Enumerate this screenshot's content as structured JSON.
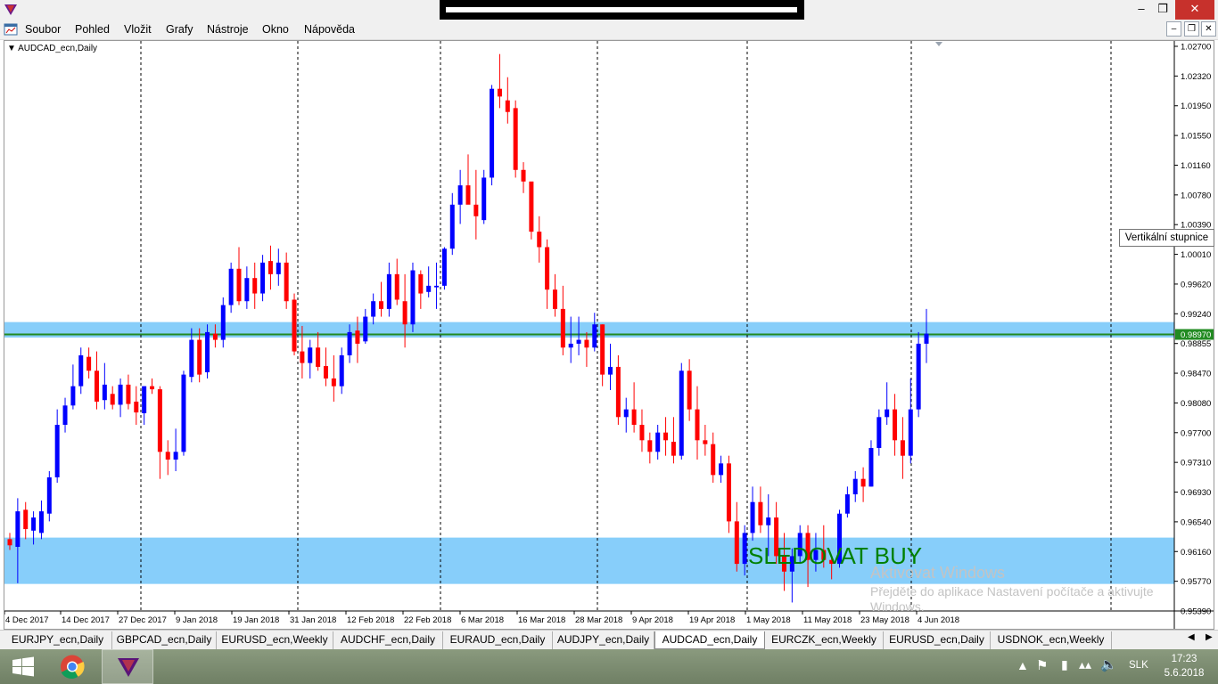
{
  "menu": {
    "items": [
      "Soubor",
      "Pohled",
      "Vložit",
      "Grafy",
      "Nástroje",
      "Okno",
      "Nápověda"
    ]
  },
  "chart": {
    "symbol": "AUDCAD_ecn,Daily",
    "tooltip": "Vertikální stupnice",
    "price_labels": [
      "1.02700",
      "1.02320",
      "1.01950",
      "1.01550",
      "1.01160",
      "1.00780",
      "1.00390",
      "1.00010",
      "0.99620",
      "0.99240",
      "0.98855",
      "0.98470",
      "0.98080",
      "0.97700",
      "0.97310",
      "0.96930",
      "0.96540",
      "0.96160",
      "0.95770",
      "0.95390"
    ],
    "current_price": "0.98970",
    "date_labels": [
      "4 Dec 2017",
      "14 Dec 2017",
      "27 Dec 2017",
      "9 Jan 2018",
      "19 Jan 2018",
      "31 Jan 2018",
      "12 Feb 2018",
      "22 Feb 2018",
      "6 Mar 2018",
      "16 Mar 2018",
      "28 Mar 2018",
      "9 Apr 2018",
      "19 Apr 2018",
      "1 May 2018",
      "11 May 2018",
      "23 May 2018",
      "4 Jun 2018"
    ],
    "annotation": "SLEDOVAT BUY",
    "watermark": [
      "Aktivovat Windows",
      "Přejděte do aplikace Nastavení počítače a aktivujte",
      "Windows."
    ],
    "colors": {
      "bull": "#0000ff",
      "bear": "#ff0000",
      "zone": "#87cefa",
      "line": "#228b22"
    },
    "zones": [
      {
        "from": 0.9893,
        "to": 0.9913
      },
      {
        "from": 0.9574,
        "to": 0.9634
      }
    ],
    "hline": 0.9897
  },
  "chart_data": {
    "type": "candlestick",
    "title": "AUDCAD_ecn,Daily",
    "ylim": [
      0.9539,
      1.029
    ],
    "candles": [
      [
        0.9632,
        0.964,
        0.9618,
        0.9624
      ],
      [
        0.9622,
        0.9685,
        0.9575,
        0.9668
      ],
      [
        0.967,
        0.968,
        0.9632,
        0.9645
      ],
      [
        0.9643,
        0.9668,
        0.9625,
        0.966
      ],
      [
        0.964,
        0.9682,
        0.9632,
        0.9668
      ],
      [
        0.9665,
        0.972,
        0.9655,
        0.9712
      ],
      [
        0.9712,
        0.98,
        0.9705,
        0.978
      ],
      [
        0.978,
        0.9815,
        0.977,
        0.9805
      ],
      [
        0.9805,
        0.9858,
        0.98,
        0.983
      ],
      [
        0.983,
        0.988,
        0.982,
        0.987
      ],
      [
        0.9868,
        0.988,
        0.984,
        0.985
      ],
      [
        0.985,
        0.9875,
        0.98,
        0.981
      ],
      [
        0.9812,
        0.986,
        0.98,
        0.9832
      ],
      [
        0.982,
        0.983,
        0.98,
        0.9806
      ],
      [
        0.9806,
        0.984,
        0.979,
        0.9832
      ],
      [
        0.9832,
        0.9845,
        0.98,
        0.9807
      ],
      [
        0.981,
        0.983,
        0.978,
        0.9796
      ],
      [
        0.9795,
        0.983,
        0.978,
        0.983
      ],
      [
        0.983,
        0.984,
        0.982,
        0.9826
      ],
      [
        0.9826,
        0.983,
        0.971,
        0.9745
      ],
      [
        0.9745,
        0.976,
        0.9715,
        0.9735
      ],
      [
        0.9735,
        0.9775,
        0.972,
        0.9745
      ],
      [
        0.9745,
        0.985,
        0.974,
        0.9845
      ],
      [
        0.9842,
        0.9905,
        0.9835,
        0.989
      ],
      [
        0.989,
        0.9905,
        0.9835,
        0.9845
      ],
      [
        0.9848,
        0.991,
        0.984,
        0.99
      ],
      [
        0.9898,
        0.991,
        0.988,
        0.989
      ],
      [
        0.989,
        0.9945,
        0.988,
        0.9935
      ],
      [
        0.9935,
        0.999,
        0.9925,
        0.9982
      ],
      [
        0.9982,
        1.001,
        0.9935,
        0.994
      ],
      [
        0.994,
        0.9985,
        0.993,
        0.997
      ],
      [
        0.997,
        0.999,
        0.993,
        0.995
      ],
      [
        0.995,
        1.0,
        0.994,
        0.999
      ],
      [
        0.9992,
        1.0012,
        0.9955,
        0.9975
      ],
      [
        0.9975,
        1.0008,
        0.996,
        0.999
      ],
      [
        0.999,
        1.0003,
        0.993,
        0.994
      ],
      [
        0.9942,
        0.995,
        0.987,
        0.9875
      ],
      [
        0.9875,
        0.9908,
        0.984,
        0.986
      ],
      [
        0.986,
        0.989,
        0.984,
        0.988
      ],
      [
        0.988,
        0.99,
        0.985,
        0.9855
      ],
      [
        0.9856,
        0.988,
        0.983,
        0.984
      ],
      [
        0.984,
        0.987,
        0.981,
        0.983
      ],
      [
        0.983,
        0.988,
        0.982,
        0.987
      ],
      [
        0.987,
        0.991,
        0.986,
        0.99
      ],
      [
        0.9902,
        0.992,
        0.986,
        0.9885
      ],
      [
        0.9888,
        0.993,
        0.9885,
        0.992
      ],
      [
        0.992,
        0.995,
        0.991,
        0.994
      ],
      [
        0.994,
        0.9965,
        0.992,
        0.993
      ],
      [
        0.993,
        0.999,
        0.992,
        0.9975
      ],
      [
        0.9975,
        0.9995,
        0.9935,
        0.9942
      ],
      [
        0.994,
        0.9975,
        0.988,
        0.991
      ],
      [
        0.991,
        0.999,
        0.99,
        0.998
      ],
      [
        0.9975,
        0.998,
        0.993,
        0.995
      ],
      [
        0.9952,
        0.9985,
        0.9945,
        0.996
      ],
      [
        0.9958,
        0.999,
        0.993,
        0.996
      ],
      [
        0.996,
        1.001,
        0.9955,
        1.0008
      ],
      [
        1.0008,
        1.008,
        1.0,
        1.0065
      ],
      [
        1.0065,
        1.011,
        1.004,
        1.009
      ],
      [
        1.009,
        1.013,
        1.007,
        1.0065
      ],
      [
        1.0065,
        1.011,
        1.002,
        1.005
      ],
      [
        1.0045,
        1.011,
        1.004,
        1.01
      ],
      [
        1.01,
        1.022,
        1.009,
        1.0215
      ],
      [
        1.0215,
        1.026,
        1.019,
        1.0205
      ],
      [
        1.02,
        1.023,
        1.017,
        1.0185
      ],
      [
        1.019,
        1.02,
        1.01,
        1.011
      ],
      [
        1.011,
        1.012,
        1.008,
        1.0095
      ],
      [
        1.0095,
        1.009,
        1.002,
        1.003
      ],
      [
        1.003,
        1.005,
        0.999,
        1.001
      ],
      [
        1.001,
        1.002,
        0.993,
        0.9955
      ],
      [
        0.9955,
        0.9975,
        0.992,
        0.993
      ],
      [
        0.993,
        0.996,
        0.987,
        0.988
      ],
      [
        0.988,
        0.992,
        0.986,
        0.9885
      ],
      [
        0.9885,
        0.992,
        0.987,
        0.989
      ],
      [
        0.989,
        0.99,
        0.9855,
        0.988
      ],
      [
        0.988,
        0.9925,
        0.9875,
        0.991
      ],
      [
        0.991,
        0.991,
        0.983,
        0.9845
      ],
      [
        0.9845,
        0.9885,
        0.9825,
        0.9855
      ],
      [
        0.9855,
        0.987,
        0.978,
        0.979
      ],
      [
        0.979,
        0.9815,
        0.977,
        0.98
      ],
      [
        0.98,
        0.9835,
        0.977,
        0.978
      ],
      [
        0.978,
        0.98,
        0.9745,
        0.976
      ],
      [
        0.976,
        0.977,
        0.973,
        0.9745
      ],
      [
        0.9745,
        0.978,
        0.9735,
        0.977
      ],
      [
        0.977,
        0.979,
        0.974,
        0.976
      ],
      [
        0.9758,
        0.979,
        0.973,
        0.974
      ],
      [
        0.974,
        0.986,
        0.9735,
        0.985
      ],
      [
        0.985,
        0.9865,
        0.9785,
        0.98
      ],
      [
        0.98,
        0.983,
        0.9735,
        0.976
      ],
      [
        0.976,
        0.978,
        0.974,
        0.9755
      ],
      [
        0.9755,
        0.977,
        0.9705,
        0.9715
      ],
      [
        0.9715,
        0.974,
        0.9705,
        0.973
      ],
      [
        0.973,
        0.974,
        0.964,
        0.9655
      ],
      [
        0.9655,
        0.968,
        0.959,
        0.96
      ],
      [
        0.96,
        0.965,
        0.9585,
        0.964
      ],
      [
        0.964,
        0.97,
        0.963,
        0.968
      ],
      [
        0.968,
        0.97,
        0.964,
        0.965
      ],
      [
        0.965,
        0.969,
        0.961,
        0.966
      ],
      [
        0.966,
        0.968,
        0.96,
        0.961
      ],
      [
        0.961,
        0.964,
        0.9565,
        0.959
      ],
      [
        0.959,
        0.962,
        0.955,
        0.961
      ],
      [
        0.961,
        0.965,
        0.96,
        0.964
      ],
      [
        0.964,
        0.965,
        0.957,
        0.9605
      ],
      [
        0.9605,
        0.964,
        0.959,
        0.9618
      ],
      [
        0.9618,
        0.965,
        0.9595,
        0.9605
      ],
      [
        0.9605,
        0.961,
        0.958,
        0.96
      ],
      [
        0.96,
        0.967,
        0.9595,
        0.9665
      ],
      [
        0.9665,
        0.97,
        0.966,
        0.969
      ],
      [
        0.969,
        0.972,
        0.968,
        0.971
      ],
      [
        0.971,
        0.9725,
        0.968,
        0.97
      ],
      [
        0.97,
        0.976,
        0.97,
        0.975
      ],
      [
        0.975,
        0.98,
        0.974,
        0.979
      ],
      [
        0.979,
        0.9835,
        0.978,
        0.98
      ],
      [
        0.98,
        0.982,
        0.974,
        0.976
      ],
      [
        0.976,
        0.979,
        0.971,
        0.974
      ],
      [
        0.974,
        0.984,
        0.973,
        0.98
      ],
      [
        0.98,
        0.99,
        0.979,
        0.9885
      ],
      [
        0.9885,
        0.993,
        0.986,
        0.9898
      ]
    ]
  },
  "tabs": [
    "EURJPY_ecn,Daily",
    "GBPCAD_ecn,Daily",
    "EURUSD_ecn,Weekly",
    "AUDCHF_ecn,Daily",
    "EURAUD_ecn,Daily",
    "AUDJPY_ecn,Daily",
    "AUDCAD_ecn,Daily",
    "EURCZK_ecn,Weekly",
    "EURUSD_ecn,Daily",
    "USDNOK_ecn,Weekly"
  ],
  "taskbar": {
    "lang": "SLK",
    "time": "17:23",
    "date": "5.6.2018"
  }
}
